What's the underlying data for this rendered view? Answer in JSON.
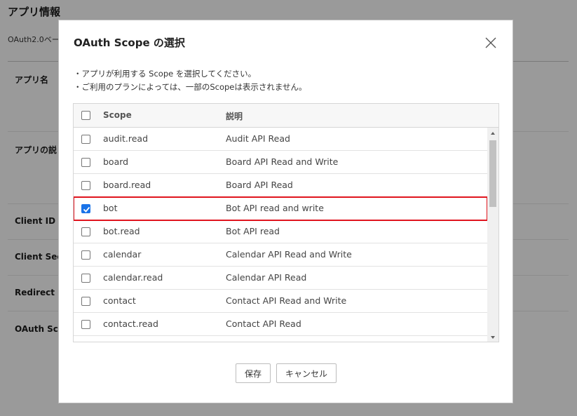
{
  "background": {
    "page_title": "アプリ情報",
    "subtitle": "OAuth2.0ベー",
    "labels": [
      "アプリ名",
      "アプリの説",
      "Client ID",
      "Client Sec",
      "Redirect U",
      "OAuth Sco"
    ]
  },
  "modal": {
    "title": "OAuth Scope の選択",
    "instructions": [
      "・アプリが利用する Scope を選択してください。",
      "・ご利用のプランによっては、一部のScopeは表示されません。"
    ],
    "table": {
      "headers": {
        "scope": "Scope",
        "description": "説明"
      },
      "rows": [
        {
          "scope": "audit.read",
          "description": "Audit API Read",
          "checked": false
        },
        {
          "scope": "board",
          "description": "Board API Read and Write",
          "checked": false
        },
        {
          "scope": "board.read",
          "description": "Board API Read",
          "checked": false
        },
        {
          "scope": "bot",
          "description": "Bot API read and write",
          "checked": true
        },
        {
          "scope": "bot.read",
          "description": "Bot API read",
          "checked": false
        },
        {
          "scope": "calendar",
          "description": "Calendar API Read and Write",
          "checked": false
        },
        {
          "scope": "calendar.read",
          "description": "Calendar API Read",
          "checked": false
        },
        {
          "scope": "contact",
          "description": "Contact API Read and Write",
          "checked": false
        },
        {
          "scope": "contact.read",
          "description": "Contact API Read",
          "checked": false
        }
      ]
    },
    "buttons": {
      "save": "保存",
      "cancel": "キャンセル"
    },
    "colors": {
      "accent": "#1a73e8",
      "highlight": "#e0141e"
    }
  }
}
